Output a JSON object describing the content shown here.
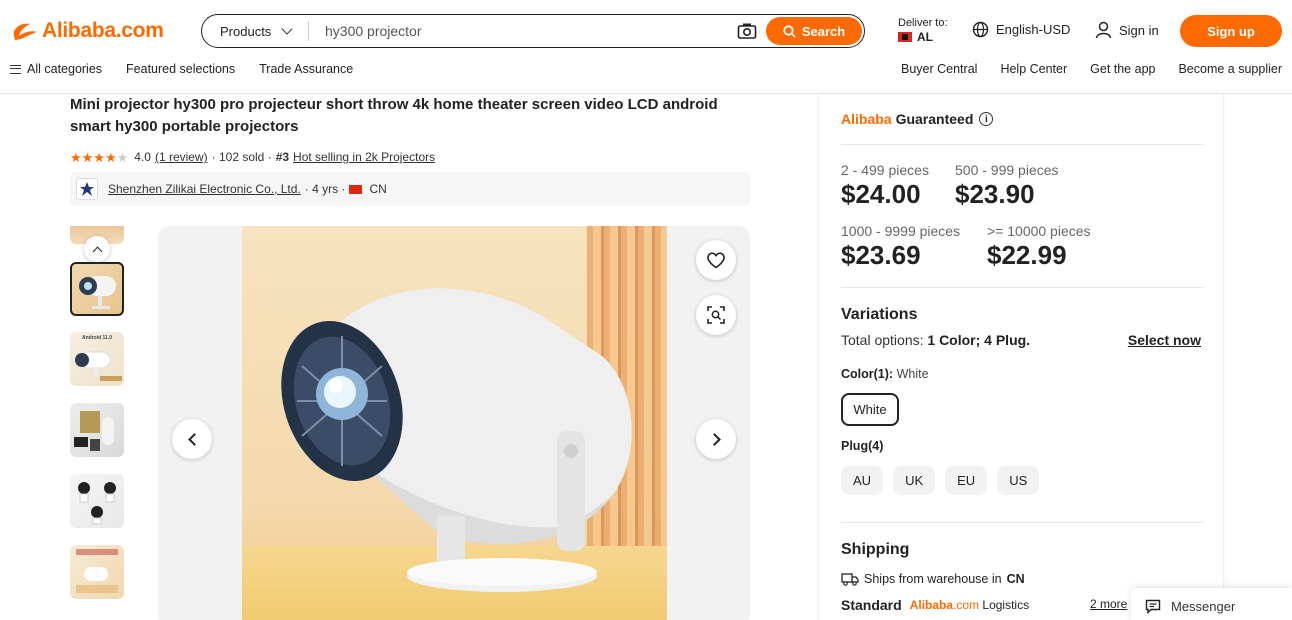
{
  "header": {
    "logo_text": "Alibaba.com",
    "search": {
      "category": "Products",
      "value": "hy300 projector",
      "button_label": "Search"
    },
    "deliver": {
      "label": "Deliver to:",
      "country": "AL"
    },
    "language": "English-USD",
    "signin_label": "Sign in",
    "signup_label": "Sign up",
    "nav_left": [
      "All categories",
      "Featured selections",
      "Trade Assurance"
    ],
    "nav_right": [
      "Buyer Central",
      "Help Center",
      "Get the app",
      "Become a supplier"
    ]
  },
  "product": {
    "title": "Mini projector hy300 pro projecteur short throw 4k home theater screen video LCD android smart hy300 portable projectors",
    "rating": "4.0",
    "rating_value": 4,
    "review_link": "(1 review)",
    "sold": "· 102 sold ·",
    "rank": "#3",
    "rank_text": "Hot selling in 2k Projectors",
    "supplier": {
      "name": "Shenzhen Zilikai Electronic Co., Ltd.",
      "years": "· 4 yrs ·",
      "country": "CN"
    },
    "thumb_label": "Android 11.0"
  },
  "panel": {
    "guarantee": {
      "brand": "Alibaba",
      "word": "Guaranteed"
    },
    "tiers": [
      {
        "range": "2 - 499 pieces",
        "price": "$24.00"
      },
      {
        "range": "500 - 999 pieces",
        "price": "$23.90"
      },
      {
        "range": "1000 - 9999 pieces",
        "price": "$23.69"
      },
      {
        "range": ">= 10000 pieces",
        "price": "$22.99"
      }
    ],
    "variations_title": "Variations",
    "total_options_label": "Total options:",
    "total_options_value": "1 Color; 4 Plug.",
    "select_now": "Select now",
    "color_label": "Color(1):",
    "color_value": "White",
    "color_option": "White",
    "plug_label": "Plug(4)",
    "plugs": [
      "AU",
      "UK",
      "EU",
      "US"
    ],
    "shipping_title": "Shipping",
    "ships_from": "Ships from warehouse in",
    "ships_country": "CN",
    "standard_label": "Standard",
    "logistics_brand": "Alibaba",
    "logistics_suffix": ".com",
    "logistics_word": "Logistics",
    "more_link": "2 more"
  },
  "messenger_label": "Messenger",
  "colors": {
    "accent": "#ff6a00",
    "text": "#222222"
  }
}
